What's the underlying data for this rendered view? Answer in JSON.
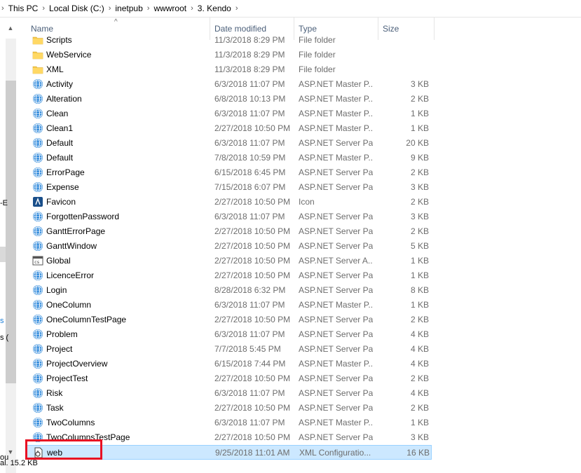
{
  "breadcrumb": [
    "This PC",
    "Local Disk (C:)",
    "inetpub",
    "wwwroot",
    "3. Kendo"
  ],
  "columns": {
    "name": "Name",
    "date": "Date modified",
    "type": "Type",
    "size": "Size"
  },
  "nav_fragments": {
    "a": "-E",
    "b": "s",
    "c": "s (",
    "d": "ou"
  },
  "status": "al. 15.2 KB",
  "rows": [
    {
      "name": "Scripts",
      "date": "11/3/2018 8:29 PM",
      "type": "File folder",
      "size": "",
      "icon": "folder"
    },
    {
      "name": "WebService",
      "date": "11/3/2018 8:29 PM",
      "type": "File folder",
      "size": "",
      "icon": "folder"
    },
    {
      "name": "XML",
      "date": "11/3/2018 8:29 PM",
      "type": "File folder",
      "size": "",
      "icon": "folder"
    },
    {
      "name": "Activity",
      "date": "6/3/2018 11:07 PM",
      "type": "ASP.NET Master P...",
      "size": "3 KB",
      "icon": "globe"
    },
    {
      "name": "Alteration",
      "date": "6/8/2018 10:13 PM",
      "type": "ASP.NET Master P...",
      "size": "2 KB",
      "icon": "globe"
    },
    {
      "name": "Clean",
      "date": "6/3/2018 11:07 PM",
      "type": "ASP.NET Master P...",
      "size": "1 KB",
      "icon": "globe"
    },
    {
      "name": "Clean1",
      "date": "2/27/2018 10:50 PM",
      "type": "ASP.NET Master P...",
      "size": "1 KB",
      "icon": "globe"
    },
    {
      "name": "Default",
      "date": "6/3/2018 11:07 PM",
      "type": "ASP.NET Server Pa...",
      "size": "20 KB",
      "icon": "globe"
    },
    {
      "name": "Default",
      "date": "7/8/2018 10:59 PM",
      "type": "ASP.NET Master P...",
      "size": "9 KB",
      "icon": "globe"
    },
    {
      "name": "ErrorPage",
      "date": "6/15/2018 6:45 PM",
      "type": "ASP.NET Server Pa...",
      "size": "2 KB",
      "icon": "globe"
    },
    {
      "name": "Expense",
      "date": "7/15/2018 6:07 PM",
      "type": "ASP.NET Server Pa...",
      "size": "3 KB",
      "icon": "globe"
    },
    {
      "name": "Favicon",
      "date": "2/27/2018 10:50 PM",
      "type": "Icon",
      "size": "2 KB",
      "icon": "favicon"
    },
    {
      "name": "ForgottenPassword",
      "date": "6/3/2018 11:07 PM",
      "type": "ASP.NET Server Pa...",
      "size": "3 KB",
      "icon": "globe"
    },
    {
      "name": "GanttErrorPage",
      "date": "2/27/2018 10:50 PM",
      "type": "ASP.NET Server Pa...",
      "size": "2 KB",
      "icon": "globe"
    },
    {
      "name": "GanttWindow",
      "date": "2/27/2018 10:50 PM",
      "type": "ASP.NET Server Pa...",
      "size": "5 KB",
      "icon": "globe"
    },
    {
      "name": "Global",
      "date": "2/27/2018 10:50 PM",
      "type": "ASP.NET Server A...",
      "size": "1 KB",
      "icon": "global"
    },
    {
      "name": "LicenceError",
      "date": "2/27/2018 10:50 PM",
      "type": "ASP.NET Server Pa...",
      "size": "1 KB",
      "icon": "globe"
    },
    {
      "name": "Login",
      "date": "8/28/2018 6:32 PM",
      "type": "ASP.NET Server Pa...",
      "size": "8 KB",
      "icon": "globe"
    },
    {
      "name": "OneColumn",
      "date": "6/3/2018 11:07 PM",
      "type": "ASP.NET Master P...",
      "size": "1 KB",
      "icon": "globe"
    },
    {
      "name": "OneColumnTestPage",
      "date": "2/27/2018 10:50 PM",
      "type": "ASP.NET Server Pa...",
      "size": "2 KB",
      "icon": "globe"
    },
    {
      "name": "Problem",
      "date": "6/3/2018 11:07 PM",
      "type": "ASP.NET Server Pa...",
      "size": "4 KB",
      "icon": "globe"
    },
    {
      "name": "Project",
      "date": "7/7/2018 5:45 PM",
      "type": "ASP.NET Server Pa...",
      "size": "4 KB",
      "icon": "globe"
    },
    {
      "name": "ProjectOverview",
      "date": "6/15/2018 7:44 PM",
      "type": "ASP.NET Master P...",
      "size": "4 KB",
      "icon": "globe"
    },
    {
      "name": "ProjectTest",
      "date": "2/27/2018 10:50 PM",
      "type": "ASP.NET Server Pa...",
      "size": "2 KB",
      "icon": "globe"
    },
    {
      "name": "Risk",
      "date": "6/3/2018 11:07 PM",
      "type": "ASP.NET Server Pa...",
      "size": "4 KB",
      "icon": "globe"
    },
    {
      "name": "Task",
      "date": "2/27/2018 10:50 PM",
      "type": "ASP.NET Server Pa...",
      "size": "2 KB",
      "icon": "globe"
    },
    {
      "name": "TwoColumns",
      "date": "6/3/2018 11:07 PM",
      "type": "ASP.NET Master P...",
      "size": "1 KB",
      "icon": "globe"
    },
    {
      "name": "TwoColumnsTestPage",
      "date": "2/27/2018 10:50 PM",
      "type": "ASP.NET Server Pa...",
      "size": "3 KB",
      "icon": "globe"
    },
    {
      "name": "web",
      "date": "9/25/2018 11:01 AM",
      "type": "XML Configuratio...",
      "size": "16 KB",
      "icon": "config",
      "selected": true
    }
  ],
  "colors": {
    "selected_bg": "#cce8ff",
    "highlight": "#e81123",
    "folder": "#f5c94a",
    "globe": "#1d7fd8"
  }
}
